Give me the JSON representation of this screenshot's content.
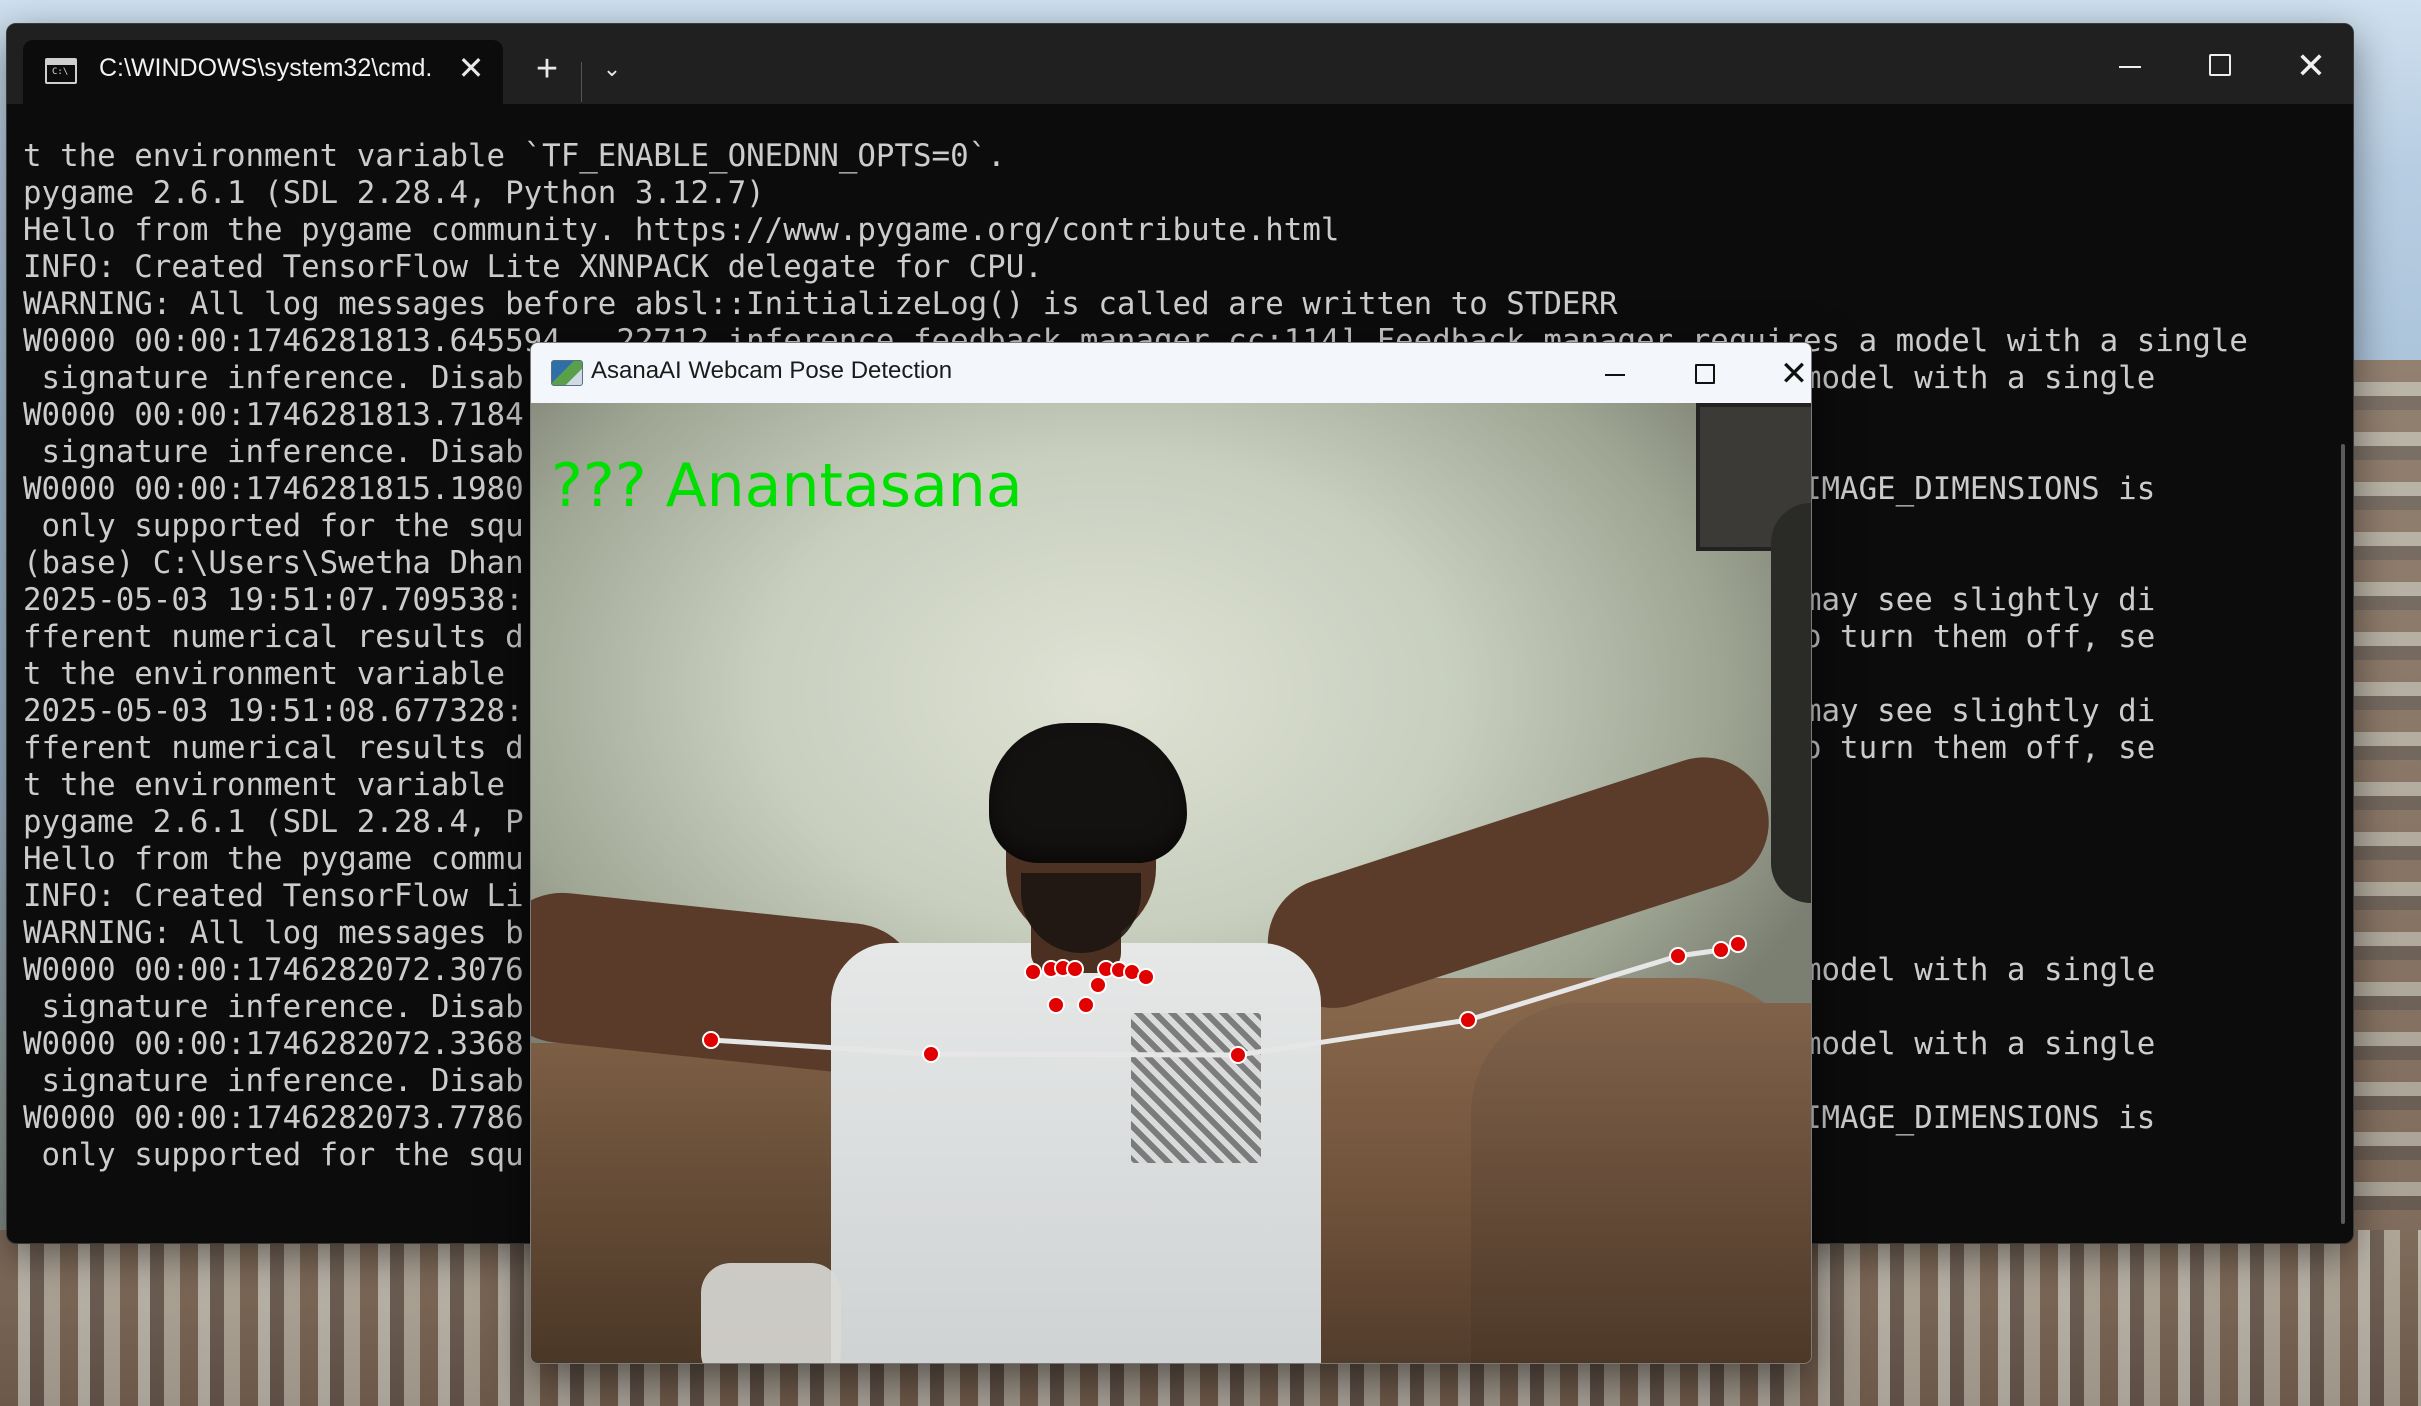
{
  "terminal": {
    "tab_title": "C:\\WINDOWS\\system32\\cmd.",
    "new_tab": "+",
    "dropdown": "⌄",
    "close_tab": "✕",
    "window_close": "✕",
    "lines": [
      "t the environment variable `TF_ENABLE_ONEDNN_OPTS=0`.",
      "pygame 2.6.1 (SDL 2.28.4, Python 3.12.7)",
      "Hello from the pygame community. https://www.pygame.org/contribute.html",
      "INFO: Created TensorFlow Lite XNNPACK delegate for CPU.",
      "WARNING: All log messages before absl::InitializeLog() is called are written to STDERR",
      "W0000 00:00:1746281813.645594   22712 inference_feedback_manager.cc:114] Feedback manager requires a model with a single",
      " signature inference. Disab                                                              ires a model with a single",
      "W0000 00:00:1746281813.7184",
      " signature inference. Disab",
      "W0000 00:00:1746281815.1980                                                              ithout IMAGE_DIMENSIONS is",
      " only supported for the squ",
      "",
      "(base) C:\\Users\\Swetha Dhan",
      "2025-05-03 19:51:07.709538:                                                              n. You may see slightly di",
      "fferent numerical results d                                                              ders. To turn them off, se",
      "t the environment variable",
      "2025-05-03 19:51:08.677328:                                                              n. You may see slightly di",
      "fferent numerical results d                                                              ders. To turn them off, se",
      "t the environment variable",
      "pygame 2.6.1 (SDL 2.28.4, P",
      "Hello from the pygame commu",
      "INFO: Created TensorFlow Li",
      "WARNING: All log messages b",
      "W0000 00:00:1746282072.3076                                                              ires a model with a single",
      " signature inference. Disab",
      "W0000 00:00:1746282072.3368                                                              ires a model with a single",
      " signature inference. Disab",
      "W0000 00:00:1746282073.7786                                                              ithout IMAGE_DIMENSIONS is",
      " only supported for the squ"
    ]
  },
  "pose_window": {
    "title": "AsanaAI Webcam Pose Detection",
    "close": "✕",
    "label": "??? Anantasana",
    "label_color": "#00e000",
    "keypoint_color": "#e00000",
    "skeleton_color": "#e6e6e6"
  }
}
